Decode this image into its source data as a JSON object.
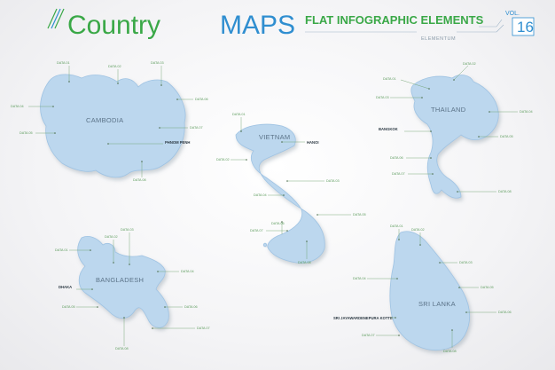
{
  "header": {
    "title_country": "Country",
    "title_maps": "MAPS",
    "subtitle": "FLAT INFOGRAPHIC ELEMENTS",
    "brand": "ELEMENTUM",
    "vol_label": "VOL.",
    "vol_number": "16"
  },
  "data_label": "DATA",
  "colors": {
    "green": "#3aa847",
    "blue": "#2f8ed0",
    "map_fill": "#bcd7ee"
  },
  "maps": {
    "cambodia": {
      "name": "CAMBODIA",
      "capital": "PHNOM PENH"
    },
    "vietnam": {
      "name": "VIETNAM",
      "capital": "HANOI"
    },
    "thailand": {
      "name": "THAILAND",
      "capital": "BANGKOK"
    },
    "bangladesh": {
      "name": "BANGLADESH",
      "capital": "DHAKA"
    },
    "srilanka": {
      "name": "SRI LANKA",
      "capital": "SRI JAYAWARDENEPURA KOTTE"
    }
  },
  "callouts": {
    "cambodia": [
      "01",
      "02",
      "03",
      "04",
      "05",
      "06",
      "07",
      "08"
    ],
    "vietnam": [
      "01",
      "02",
      "03",
      "04",
      "05",
      "06",
      "07",
      "08"
    ],
    "thailand": [
      "01",
      "02",
      "03",
      "04",
      "05",
      "06",
      "07",
      "08"
    ],
    "bangladesh": [
      "01",
      "02",
      "03",
      "04",
      "05",
      "06",
      "07",
      "08"
    ],
    "srilanka": [
      "01",
      "02",
      "03",
      "04",
      "05",
      "06",
      "07",
      "08"
    ]
  }
}
